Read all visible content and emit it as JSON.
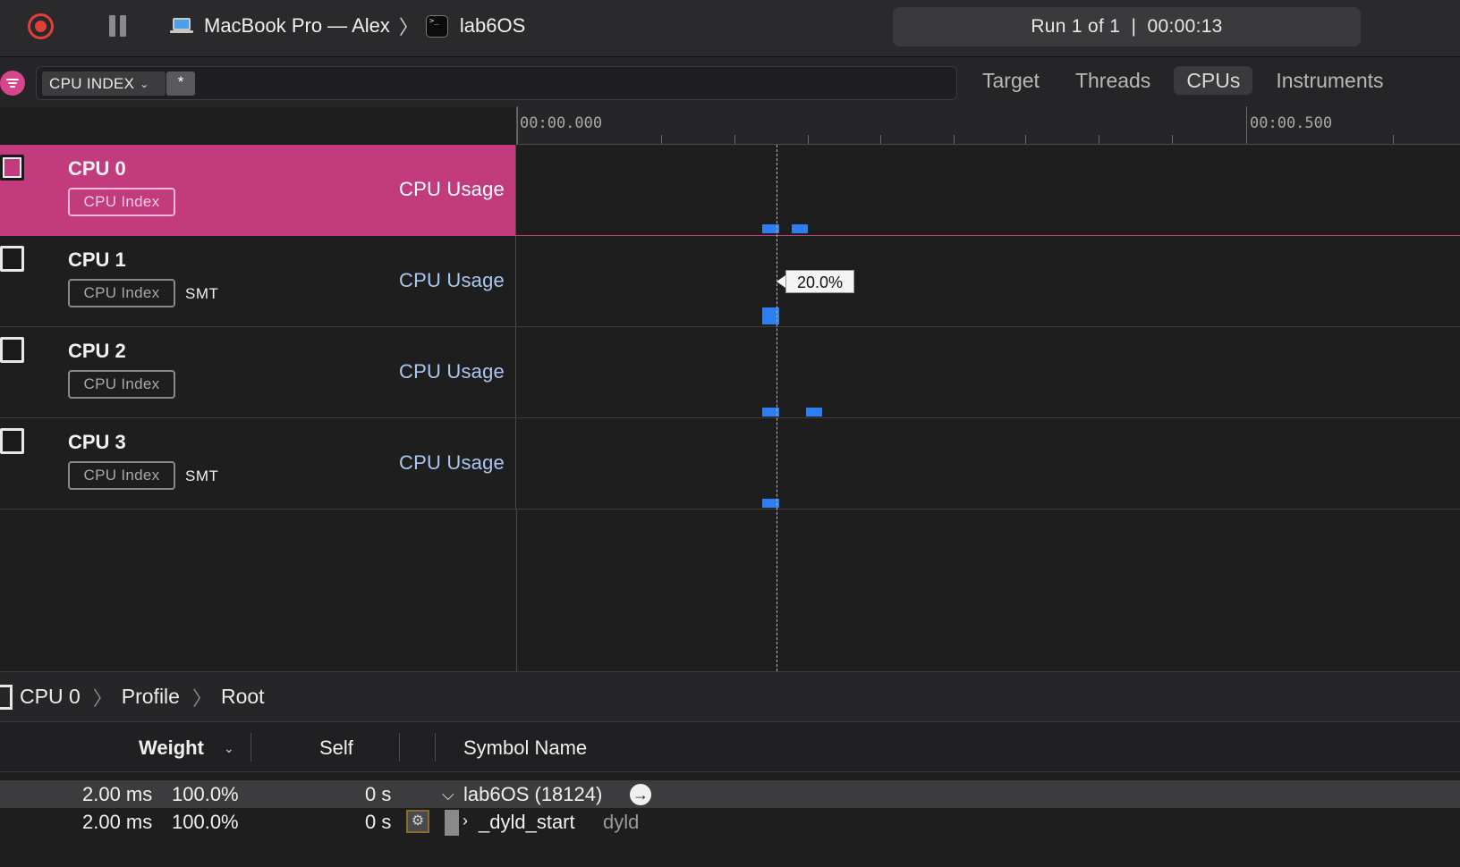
{
  "toolbar": {
    "device_name": "MacBook Pro — Alex",
    "target_name": "lab6OS",
    "run_status": "Run 1 of 1  |  00:00:13"
  },
  "filter": {
    "token_label": "CPU INDEX",
    "token_wildcard": "*"
  },
  "tabs": [
    {
      "label": "Target",
      "active": false
    },
    {
      "label": "Threads",
      "active": false
    },
    {
      "label": "CPUs",
      "active": true
    },
    {
      "label": "Instruments",
      "active": false
    }
  ],
  "ruler": {
    "start_label": "00:00.000",
    "end_label": "00:00.500"
  },
  "tracks": [
    {
      "name": "CPU 0",
      "tag": "CPU Index",
      "extra": "",
      "usage_label": "CPU Usage",
      "selected": true
    },
    {
      "name": "CPU 1",
      "tag": "CPU Index",
      "extra": "SMT",
      "usage_label": "CPU Usage",
      "selected": false
    },
    {
      "name": "CPU 2",
      "tag": "CPU Index",
      "extra": "",
      "usage_label": "CPU Usage",
      "selected": false
    },
    {
      "name": "CPU 3",
      "tag": "CPU Index",
      "extra": "SMT",
      "usage_label": "CPU Usage",
      "selected": false
    }
  ],
  "tooltip": {
    "value": "20.0%"
  },
  "breadcrumb": {
    "items": [
      "CPU 0",
      "Profile",
      "Root"
    ]
  },
  "table": {
    "columns": {
      "weight": "Weight",
      "self": "Self",
      "symbol": "Symbol Name"
    },
    "rows": [
      {
        "weight": "2.00 ms",
        "percent": "100.0%",
        "self": "0 s",
        "symbol": "lab6OS (18124)",
        "library": ""
      },
      {
        "weight": "2.00 ms",
        "percent": "100.0%",
        "self": "0 s",
        "symbol": "_dyld_start",
        "library": "dyld"
      }
    ]
  },
  "colors": {
    "accent_pink": "#c23b7d",
    "usage_blue": "#2d7ff0",
    "record_red": "#e0403a"
  }
}
